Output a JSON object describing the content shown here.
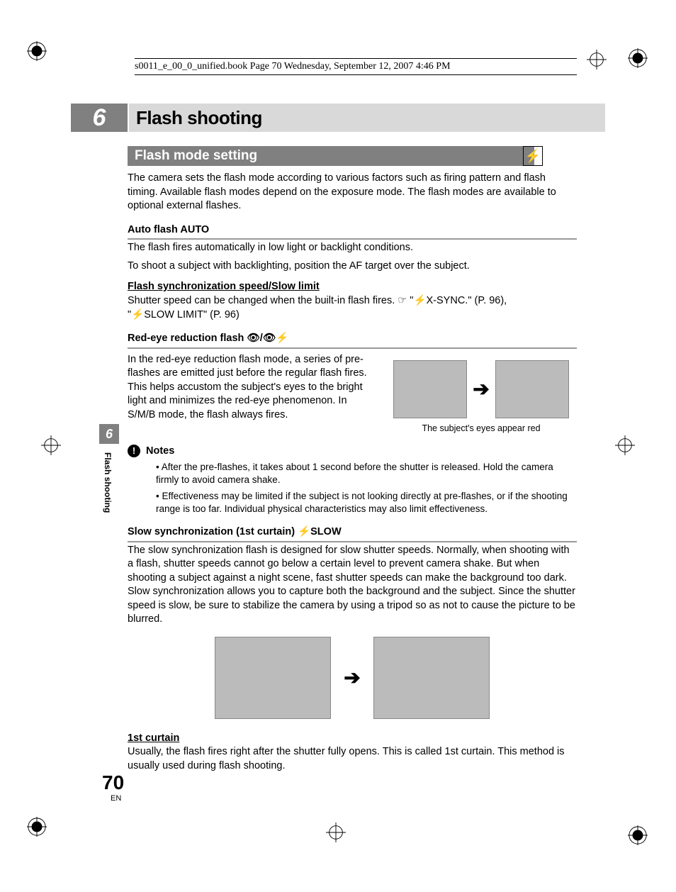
{
  "running_header": "s0011_e_00_0_unified.book  Page 70  Wednesday, September 12, 2007  4:46 PM",
  "chapter_number": "6",
  "chapter_title": "Flash shooting",
  "section_title": "Flash mode setting",
  "flash_glyph": "⚡",
  "intro": "The camera sets the flash mode according to various factors such as firing pattern and flash timing. Available flash modes depend on the exposure mode. The flash modes are available to optional external flashes.",
  "auto_flash": {
    "heading": "Auto flash  AUTO",
    "line1": "The flash fires automatically in low light or backlight conditions.",
    "line2": "To shoot a subject with backlighting, position the AF target over the subject."
  },
  "sync_speed": {
    "heading": "Flash synchronization speed/Slow limit",
    "body_pre": "Shutter speed can be changed when the built-in flash fires.  ",
    "ref1": "☞ \"⚡X-SYNC.\" (P. 96),",
    "ref2": "\"⚡SLOW LIMIT\" (P. 96)"
  },
  "red_eye": {
    "heading": "Red-eye reduction flash  👁/👁⚡",
    "body": "In the red-eye reduction flash mode, a series of pre-flashes are emitted just before the regular flash fires. This helps accustom the subject's eyes to the bright light and minimizes the red-eye phenomenon. In S/M/B mode, the flash always fires.",
    "caption": "The subject's eyes appear red"
  },
  "notes": {
    "label": "Notes",
    "items": [
      "After the pre-flashes, it takes about 1 second before the shutter is released. Hold the camera firmly to avoid camera shake.",
      "Effectiveness may be limited if the subject is not looking directly at pre-flashes, or if the shooting range is too far. Individual physical characteristics may also limit effectiveness."
    ]
  },
  "slow_sync": {
    "heading": "Slow synchronization (1st curtain)  ⚡SLOW",
    "body": "The slow synchronization flash is designed for slow shutter speeds. Normally, when shooting with a flash, shutter speeds cannot go below a certain level to prevent camera shake. But when shooting a subject against a night scene, fast shutter speeds can make the background too dark. Slow synchronization allows you to capture both the background and the subject. Since the shutter speed is slow, be sure to stabilize the camera by using a tripod so as not to cause the picture to be blurred."
  },
  "first_curtain": {
    "heading": "1st curtain",
    "body": "Usually, the flash fires right after the shutter fully opens. This is called 1st curtain. This method is usually used during flash shooting."
  },
  "side_tab_number": "6",
  "side_label": "Flash shooting",
  "page_number": "70",
  "page_lang": "EN"
}
